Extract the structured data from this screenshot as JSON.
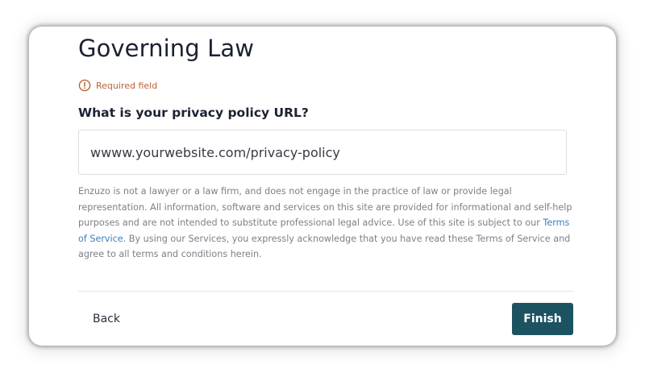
{
  "page": {
    "title": "Governing Law",
    "required_label": "Required field",
    "question": "What is your privacy policy URL?"
  },
  "url_field": {
    "value": "wwww.yourwebsite.com/privacy-policy"
  },
  "disclaimer": {
    "text_before_link": "Enzuzo is not a lawyer or a law firm, and does not engage in the practice of law or provide legal representation. All information, software and services on this site are provided for informational and self-help purposes and are not intended to substitute professional legal advice. Use of this site is subject to our ",
    "link_text": "Terms of Service",
    "text_after_link": ". By using our Services, you expressly acknowledge that you have read these Terms of Service and agree to all terms and conditions herein."
  },
  "footer": {
    "back_label": "Back",
    "finish_label": "Finish"
  },
  "icons": {
    "required": "alert-circle-icon"
  },
  "colors": {
    "heading": "#1c2133",
    "required_accent": "#b8633c",
    "link": "#3d7fbf",
    "primary_button": "#1d5361",
    "disclaimer_text": "#7d8088"
  }
}
